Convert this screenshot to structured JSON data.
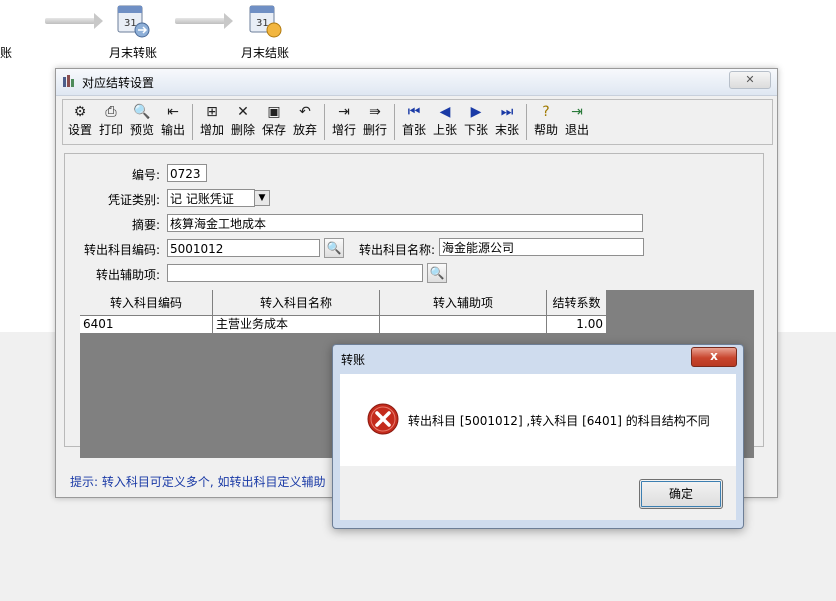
{
  "workflow": {
    "left_partial_label": "账",
    "step1_label": "月末转账",
    "step2_label": "月末结账"
  },
  "window": {
    "title": "对应结转设置",
    "close_glyph": "✕"
  },
  "toolbar": {
    "settings": "设置",
    "print": "打印",
    "preview": "预览",
    "export": "输出",
    "add": "增加",
    "delete": "删除",
    "save": "保存",
    "discard": "放弃",
    "add_row": "增行",
    "delete_row": "删行",
    "first": "首张",
    "prev": "上张",
    "next": "下张",
    "last": "末张",
    "help": "帮助",
    "exit": "退出"
  },
  "form": {
    "code_label": "编号:",
    "code_value": "0723",
    "voucher_type_label": "凭证类别:",
    "voucher_type_value": "记    记账凭证",
    "summary_label": "摘要:",
    "summary_value": "核算海金工地成本",
    "out_account_code_label": "转出科目编码:",
    "out_account_code_value": "5001012",
    "out_account_name_label": "转出科目名称:",
    "out_account_name_value": "海金能源公司",
    "out_aux_label": "转出辅助项:",
    "out_aux_value": ""
  },
  "grid": {
    "headers": [
      "转入科目编码",
      "转入科目名称",
      "转入辅助项",
      "结转系数"
    ],
    "rows": [
      [
        "6401",
        "主营业务成本",
        "",
        "1.00"
      ]
    ]
  },
  "hint": "提示: 转入科目可定义多个, 如转出科目定义辅助",
  "dialog": {
    "title": "转账",
    "close_glyph": "x",
    "message": "转出科目 [5001012] ,转入科目 [6401] 的科目结构不同",
    "ok_label": "确定"
  }
}
